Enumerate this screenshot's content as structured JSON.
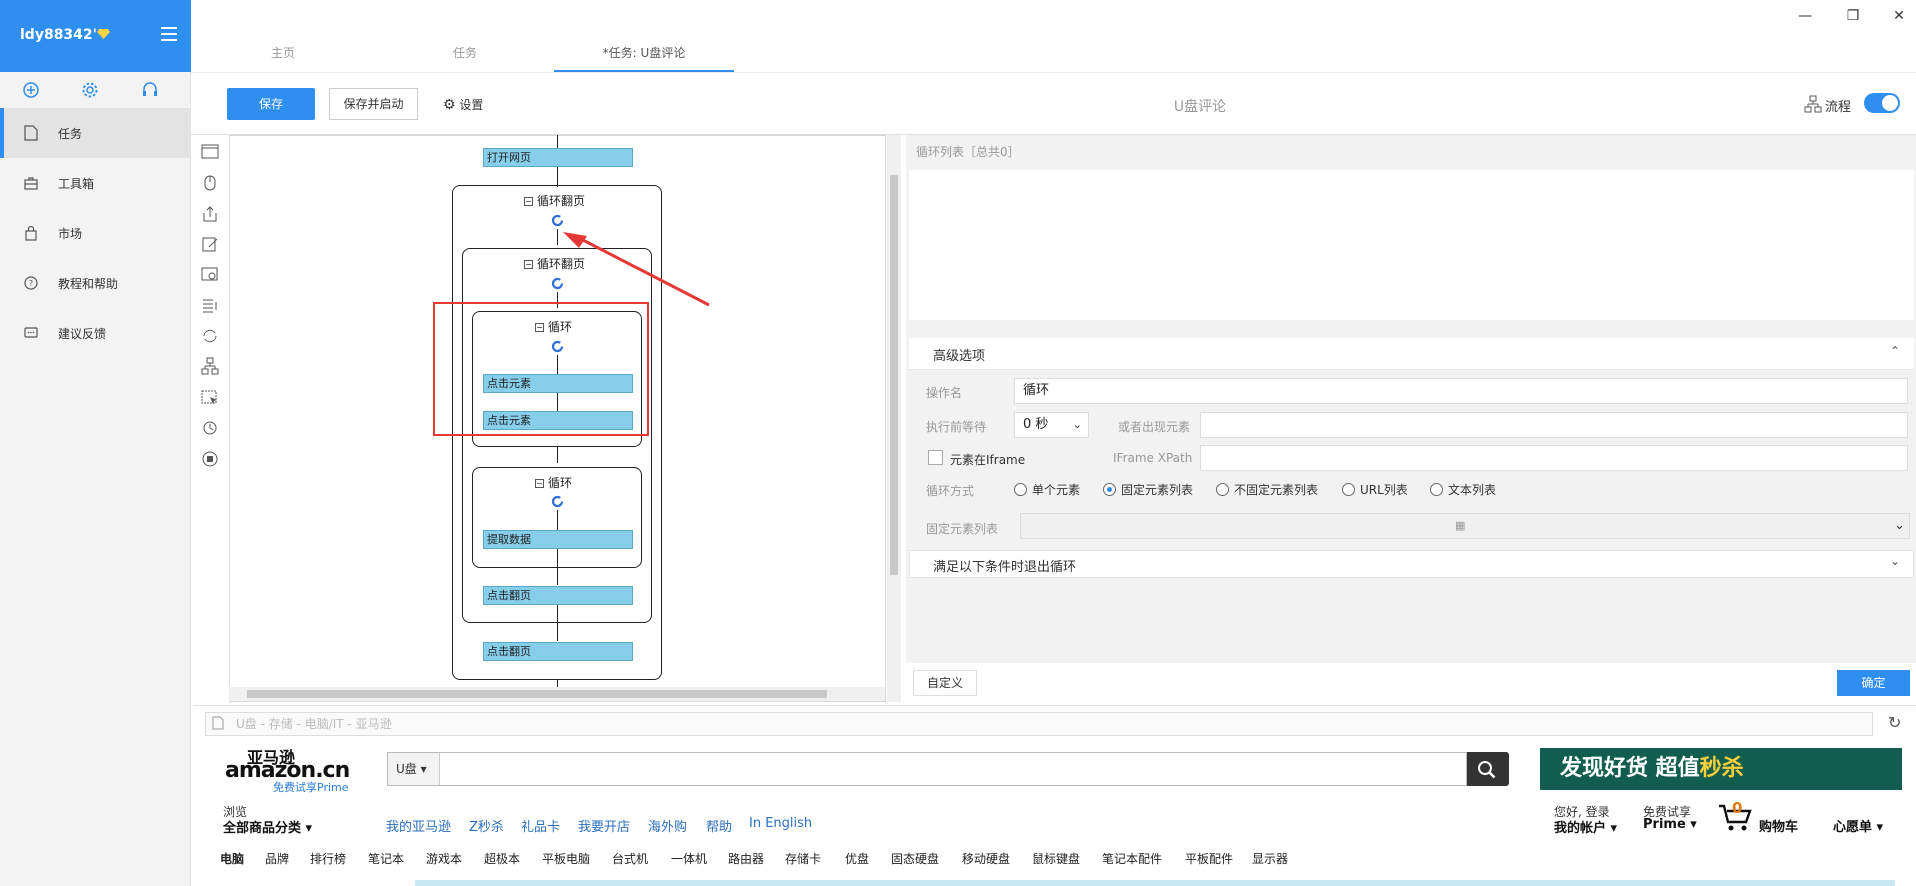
{
  "sidebar": {
    "username": "ldy88342",
    "username_suffix": "'",
    "items": [
      {
        "label": "任务",
        "icon": "document-icon"
      },
      {
        "label": "工具箱",
        "icon": "toolbox-icon"
      },
      {
        "label": "市场",
        "icon": "shopping-bag-icon"
      },
      {
        "label": "教程和帮助",
        "icon": "help-circle-icon"
      },
      {
        "label": "建议反馈",
        "icon": "feedback-icon"
      }
    ]
  },
  "tabs": [
    {
      "label": "主页"
    },
    {
      "label": "任务"
    },
    {
      "label": "*任务: U盘评论"
    }
  ],
  "toolbar": {
    "save_label": "保存",
    "save_run_label": "保存并启动",
    "settings_label": "设置",
    "title": "U盘评论",
    "flow_label": "流程"
  },
  "flow": {
    "open_page": "打开网页",
    "loop_page_1": "循环翻页",
    "loop_page_2": "循环翻页",
    "loop_a": "循环",
    "click_1": "点击元素",
    "click_2": "点击元素",
    "loop_b": "循环",
    "extract": "提取数据",
    "next_page_1": "点击翻页",
    "next_page_2": "点击翻页"
  },
  "panel": {
    "loop_list_title": "循环列表［总共0］",
    "advanced_title": "高级选项",
    "op_name_label": "操作名",
    "op_name_value": "循环",
    "wait_label": "执行前等待",
    "wait_value": "0 秒",
    "or_appear_label": "或者出现元素",
    "iframe_label": "元素在Iframe",
    "iframe_xpath_label": "IFrame XPath",
    "loop_mode_label": "循环方式",
    "loop_modes": [
      "单个元素",
      "固定元素列表",
      "不固定元素列表",
      "URL列表",
      "文本列表"
    ],
    "loop_mode_selected": 1,
    "fixed_list_label": "固定元素列表",
    "exit_condition_label": "满足以下条件时退出循环",
    "custom_label": "自定义",
    "ok_label": "确定"
  },
  "browser": {
    "url_text": "U盘 - 存储 - 电脑/IT - 亚马逊",
    "logo_cn": "亚马逊",
    "logo_en": "amazon.cn",
    "prime_text": "免费试享Prime",
    "search_category": "U盘",
    "banner_text": "发现好货 超值",
    "banner_hot": "秒杀",
    "browse_label": "浏览",
    "all_categories": "全部商品分类",
    "nav_links": [
      "我的亚马逊",
      "Z秒杀",
      "礼品卡",
      "我要开店",
      "海外购",
      "帮助",
      "In English"
    ],
    "account_top": "您好, 登录",
    "account_bottom": "我的帐户",
    "prime_top": "免费试享",
    "prime_bottom": "Prime",
    "cart_count": "0",
    "cart_label": "购物车",
    "wishlist_label": "心愿单",
    "categories": [
      "电脑",
      "品牌",
      "排行榜",
      "笔记本",
      "游戏本",
      "超极本",
      "平板电脑",
      "台式机",
      "一体机",
      "路由器",
      "存储卡",
      "优盘",
      "固态硬盘",
      "移动硬盘",
      "鼠标键盘",
      "笔记本配件",
      "平板配件",
      "显示器"
    ]
  },
  "colors": {
    "accent": "#2f8ff0",
    "node_fill": "#87ceeb",
    "highlight_red": "#e53935"
  }
}
